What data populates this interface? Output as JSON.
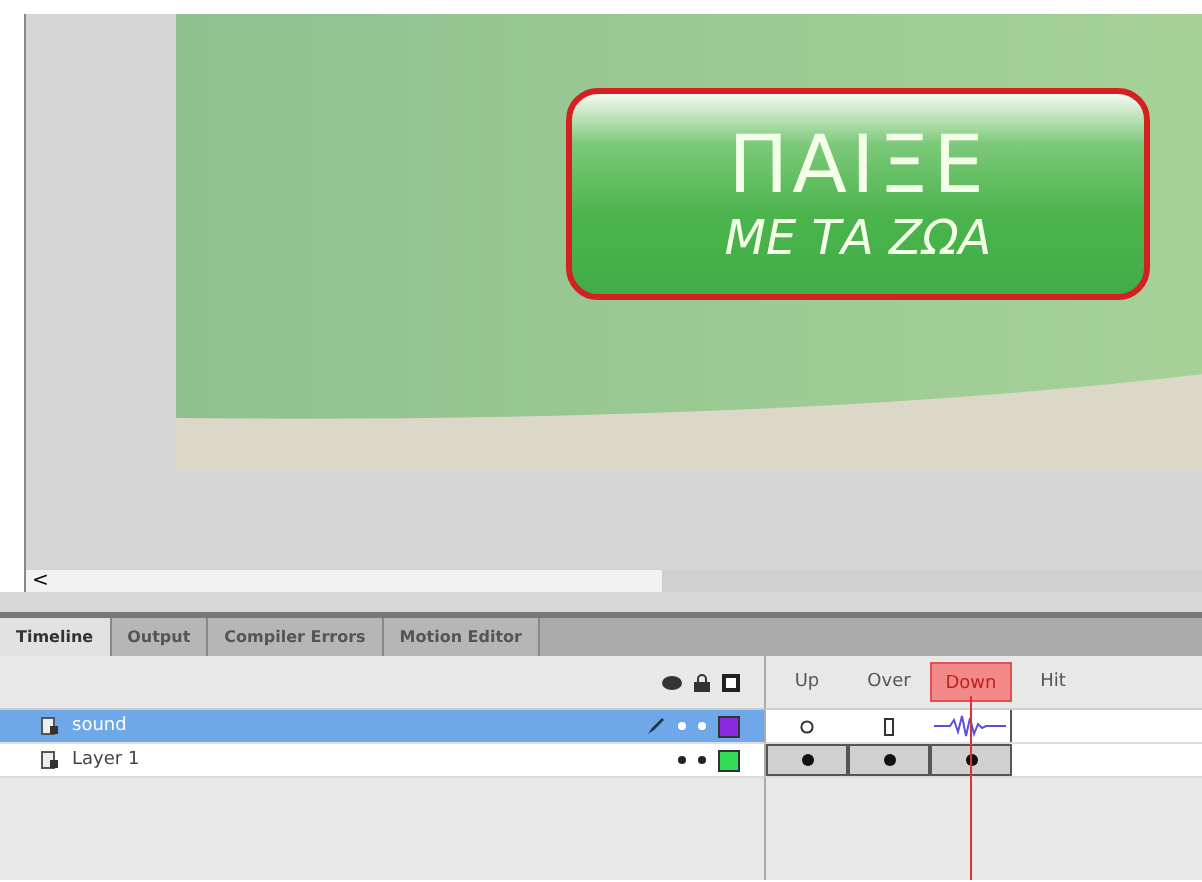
{
  "stage": {
    "button": {
      "title": "ΠΑΙΞΕ",
      "subtitle": "ΜΕ ΤΑ ΖΩΑ"
    }
  },
  "scrollbar": {
    "arrow": "<"
  },
  "tabs": [
    {
      "label": "Timeline",
      "selected": true
    },
    {
      "label": "Output",
      "selected": false
    },
    {
      "label": "Compiler Errors",
      "selected": false
    },
    {
      "label": "Motion Editor",
      "selected": false
    }
  ],
  "frame_labels": [
    {
      "label": "Up",
      "selected": false
    },
    {
      "label": "Over",
      "selected": false
    },
    {
      "label": "Down",
      "selected": true
    },
    {
      "label": "Hit",
      "selected": false
    }
  ],
  "layers": [
    {
      "name": "sound",
      "selected": true,
      "editing": true,
      "color": "#8a2be2",
      "frames": [
        {
          "kind": "empty-keyframe"
        },
        {
          "kind": "frame-end"
        },
        {
          "kind": "sound"
        },
        {
          "kind": "none"
        }
      ]
    },
    {
      "name": "Layer 1",
      "selected": false,
      "editing": false,
      "color": "#33dd55",
      "frames": [
        {
          "kind": "keyframe"
        },
        {
          "kind": "keyframe"
        },
        {
          "kind": "keyframe"
        },
        {
          "kind": "none"
        }
      ]
    }
  ]
}
